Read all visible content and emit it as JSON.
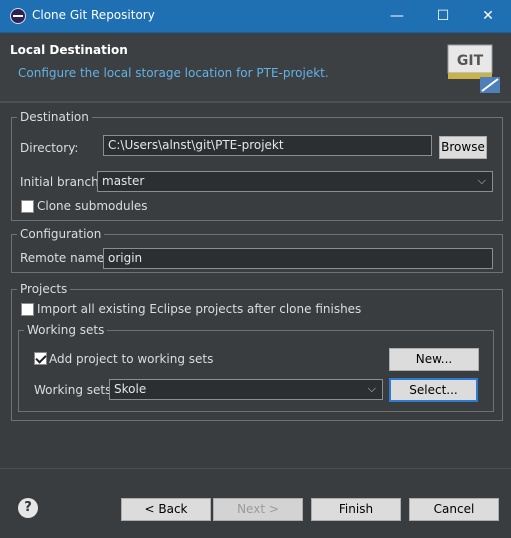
{
  "window": {
    "title": "Clone Git Repository",
    "buttons": {
      "minimize": "—",
      "maximize": "☐",
      "close": "✕"
    }
  },
  "header": {
    "title": "Local Destination",
    "description": "Configure the local storage location for PTE-projekt.",
    "logo_text": "GIT"
  },
  "destination": {
    "legend": "Destination",
    "directory_label": "Directory:",
    "directory_value": "C:\\Users\\alnst\\git\\PTE-projekt",
    "browse_label": "Browse",
    "branch_label": "Initial branch:",
    "branch_value": "master",
    "clone_submodules_label": "Clone submodules",
    "clone_submodules_checked": false
  },
  "configuration": {
    "legend": "Configuration",
    "remote_name_label": "Remote name:",
    "remote_name_value": "origin"
  },
  "projects": {
    "legend": "Projects",
    "import_label": "Import all existing Eclipse projects after clone finishes",
    "import_checked": false,
    "working_sets": {
      "legend": "Working sets",
      "add_label": "Add project to working sets",
      "add_checked": true,
      "new_label": "New...",
      "sets_label": "Working sets:",
      "sets_value": "Skole",
      "select_label": "Select..."
    }
  },
  "footer": {
    "help_icon": "?",
    "back_label": "< Back",
    "next_label": "Next >",
    "finish_label": "Finish",
    "cancel_label": "Cancel"
  },
  "colors": {
    "titlebar": "#1f6fb3",
    "dialog_bg": "#393d40",
    "description_text": "#63b2e6"
  }
}
